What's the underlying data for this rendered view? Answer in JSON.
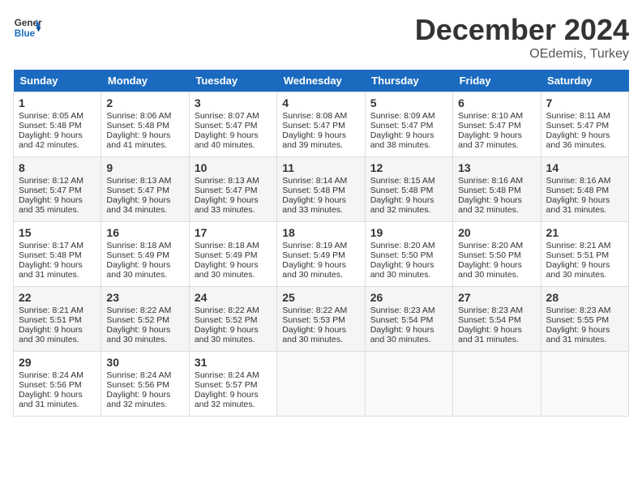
{
  "header": {
    "logo_general": "General",
    "logo_blue": "Blue",
    "title": "December 2024",
    "subtitle": "OEdemis, Turkey"
  },
  "days_of_week": [
    "Sunday",
    "Monday",
    "Tuesday",
    "Wednesday",
    "Thursday",
    "Friday",
    "Saturday"
  ],
  "weeks": [
    [
      {
        "day": "1",
        "sunrise": "Sunrise: 8:05 AM",
        "sunset": "Sunset: 5:48 PM",
        "daylight": "Daylight: 9 hours and 42 minutes."
      },
      {
        "day": "2",
        "sunrise": "Sunrise: 8:06 AM",
        "sunset": "Sunset: 5:48 PM",
        "daylight": "Daylight: 9 hours and 41 minutes."
      },
      {
        "day": "3",
        "sunrise": "Sunrise: 8:07 AM",
        "sunset": "Sunset: 5:47 PM",
        "daylight": "Daylight: 9 hours and 40 minutes."
      },
      {
        "day": "4",
        "sunrise": "Sunrise: 8:08 AM",
        "sunset": "Sunset: 5:47 PM",
        "daylight": "Daylight: 9 hours and 39 minutes."
      },
      {
        "day": "5",
        "sunrise": "Sunrise: 8:09 AM",
        "sunset": "Sunset: 5:47 PM",
        "daylight": "Daylight: 9 hours and 38 minutes."
      },
      {
        "day": "6",
        "sunrise": "Sunrise: 8:10 AM",
        "sunset": "Sunset: 5:47 PM",
        "daylight": "Daylight: 9 hours and 37 minutes."
      },
      {
        "day": "7",
        "sunrise": "Sunrise: 8:11 AM",
        "sunset": "Sunset: 5:47 PM",
        "daylight": "Daylight: 9 hours and 36 minutes."
      }
    ],
    [
      {
        "day": "8",
        "sunrise": "Sunrise: 8:12 AM",
        "sunset": "Sunset: 5:47 PM",
        "daylight": "Daylight: 9 hours and 35 minutes."
      },
      {
        "day": "9",
        "sunrise": "Sunrise: 8:13 AM",
        "sunset": "Sunset: 5:47 PM",
        "daylight": "Daylight: 9 hours and 34 minutes."
      },
      {
        "day": "10",
        "sunrise": "Sunrise: 8:13 AM",
        "sunset": "Sunset: 5:47 PM",
        "daylight": "Daylight: 9 hours and 33 minutes."
      },
      {
        "day": "11",
        "sunrise": "Sunrise: 8:14 AM",
        "sunset": "Sunset: 5:48 PM",
        "daylight": "Daylight: 9 hours and 33 minutes."
      },
      {
        "day": "12",
        "sunrise": "Sunrise: 8:15 AM",
        "sunset": "Sunset: 5:48 PM",
        "daylight": "Daylight: 9 hours and 32 minutes."
      },
      {
        "day": "13",
        "sunrise": "Sunrise: 8:16 AM",
        "sunset": "Sunset: 5:48 PM",
        "daylight": "Daylight: 9 hours and 32 minutes."
      },
      {
        "day": "14",
        "sunrise": "Sunrise: 8:16 AM",
        "sunset": "Sunset: 5:48 PM",
        "daylight": "Daylight: 9 hours and 31 minutes."
      }
    ],
    [
      {
        "day": "15",
        "sunrise": "Sunrise: 8:17 AM",
        "sunset": "Sunset: 5:48 PM",
        "daylight": "Daylight: 9 hours and 31 minutes."
      },
      {
        "day": "16",
        "sunrise": "Sunrise: 8:18 AM",
        "sunset": "Sunset: 5:49 PM",
        "daylight": "Daylight: 9 hours and 30 minutes."
      },
      {
        "day": "17",
        "sunrise": "Sunrise: 8:18 AM",
        "sunset": "Sunset: 5:49 PM",
        "daylight": "Daylight: 9 hours and 30 minutes."
      },
      {
        "day": "18",
        "sunrise": "Sunrise: 8:19 AM",
        "sunset": "Sunset: 5:49 PM",
        "daylight": "Daylight: 9 hours and 30 minutes."
      },
      {
        "day": "19",
        "sunrise": "Sunrise: 8:20 AM",
        "sunset": "Sunset: 5:50 PM",
        "daylight": "Daylight: 9 hours and 30 minutes."
      },
      {
        "day": "20",
        "sunrise": "Sunrise: 8:20 AM",
        "sunset": "Sunset: 5:50 PM",
        "daylight": "Daylight: 9 hours and 30 minutes."
      },
      {
        "day": "21",
        "sunrise": "Sunrise: 8:21 AM",
        "sunset": "Sunset: 5:51 PM",
        "daylight": "Daylight: 9 hours and 30 minutes."
      }
    ],
    [
      {
        "day": "22",
        "sunrise": "Sunrise: 8:21 AM",
        "sunset": "Sunset: 5:51 PM",
        "daylight": "Daylight: 9 hours and 30 minutes."
      },
      {
        "day": "23",
        "sunrise": "Sunrise: 8:22 AM",
        "sunset": "Sunset: 5:52 PM",
        "daylight": "Daylight: 9 hours and 30 minutes."
      },
      {
        "day": "24",
        "sunrise": "Sunrise: 8:22 AM",
        "sunset": "Sunset: 5:52 PM",
        "daylight": "Daylight: 9 hours and 30 minutes."
      },
      {
        "day": "25",
        "sunrise": "Sunrise: 8:22 AM",
        "sunset": "Sunset: 5:53 PM",
        "daylight": "Daylight: 9 hours and 30 minutes."
      },
      {
        "day": "26",
        "sunrise": "Sunrise: 8:23 AM",
        "sunset": "Sunset: 5:54 PM",
        "daylight": "Daylight: 9 hours and 30 minutes."
      },
      {
        "day": "27",
        "sunrise": "Sunrise: 8:23 AM",
        "sunset": "Sunset: 5:54 PM",
        "daylight": "Daylight: 9 hours and 31 minutes."
      },
      {
        "day": "28",
        "sunrise": "Sunrise: 8:23 AM",
        "sunset": "Sunset: 5:55 PM",
        "daylight": "Daylight: 9 hours and 31 minutes."
      }
    ],
    [
      {
        "day": "29",
        "sunrise": "Sunrise: 8:24 AM",
        "sunset": "Sunset: 5:56 PM",
        "daylight": "Daylight: 9 hours and 31 minutes."
      },
      {
        "day": "30",
        "sunrise": "Sunrise: 8:24 AM",
        "sunset": "Sunset: 5:56 PM",
        "daylight": "Daylight: 9 hours and 32 minutes."
      },
      {
        "day": "31",
        "sunrise": "Sunrise: 8:24 AM",
        "sunset": "Sunset: 5:57 PM",
        "daylight": "Daylight: 9 hours and 32 minutes."
      },
      null,
      null,
      null,
      null
    ]
  ]
}
